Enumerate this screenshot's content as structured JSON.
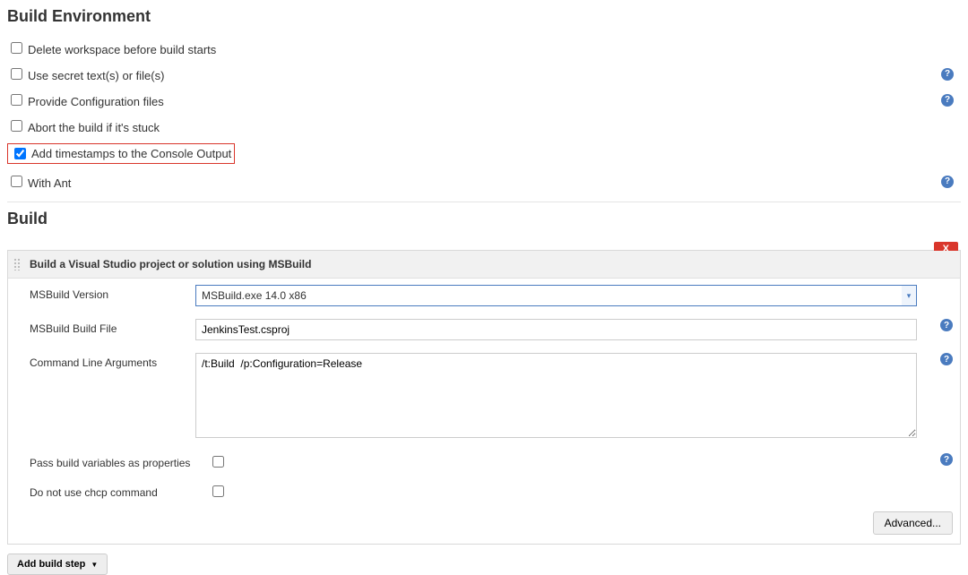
{
  "build_env": {
    "title": "Build Environment",
    "items": [
      {
        "label": "Delete workspace before build starts",
        "checked": false,
        "help": false,
        "highlight": false
      },
      {
        "label": "Use secret text(s) or file(s)",
        "checked": false,
        "help": true,
        "highlight": false
      },
      {
        "label": "Provide Configuration files",
        "checked": false,
        "help": true,
        "highlight": false
      },
      {
        "label": "Abort the build if it's stuck",
        "checked": false,
        "help": false,
        "highlight": false
      },
      {
        "label": "Add timestamps to the Console Output",
        "checked": true,
        "help": false,
        "highlight": true
      },
      {
        "label": "With Ant",
        "checked": false,
        "help": true,
        "highlight": false
      }
    ]
  },
  "build": {
    "title": "Build",
    "step_title": "Build a Visual Studio project or solution using MSBuild",
    "close": "X",
    "version": {
      "label": "MSBuild Version",
      "value": "MSBuild.exe 14.0 x86"
    },
    "buildfile": {
      "label": "MSBuild Build File",
      "value": "JenkinsTest.csproj"
    },
    "args": {
      "label": "Command Line Arguments",
      "value": "/t:Build  /p:Configuration=Release"
    },
    "pass_vars": {
      "label": "Pass build variables as properties",
      "checked": false
    },
    "chcp": {
      "label": "Do not use chcp command",
      "checked": false
    },
    "advanced": "Advanced...",
    "add_step": "Add build step"
  }
}
